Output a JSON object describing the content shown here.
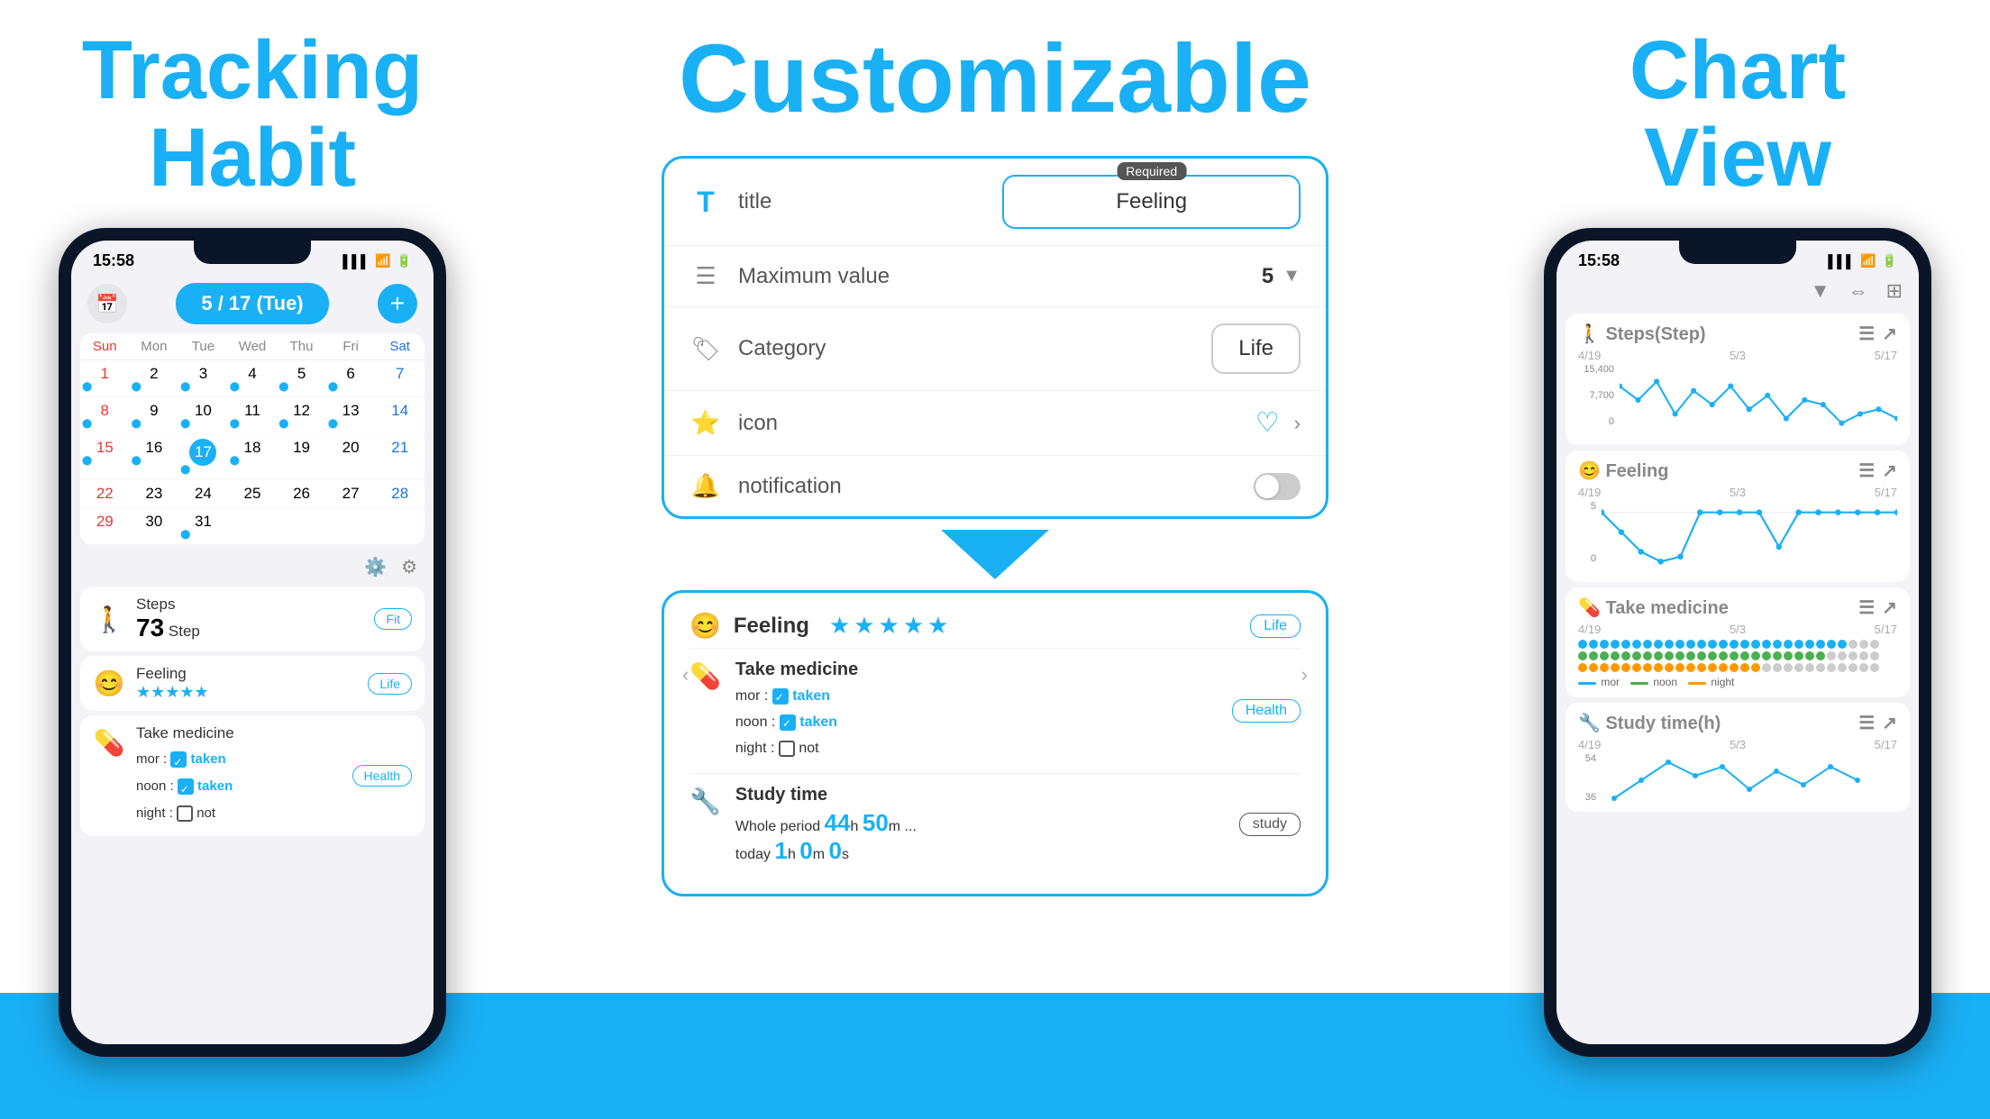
{
  "left": {
    "title_line1": "Tracking",
    "title_line2": "Habit",
    "phone": {
      "status_time": "15:58",
      "date_pill": "5 / 17 (Tue)",
      "add_btn": "+",
      "days": [
        "Sun",
        "Mon",
        "Tue",
        "Wed",
        "Thu",
        "Fri",
        "Sat"
      ],
      "weeks": [
        [
          "1",
          "2",
          "3",
          "4",
          "5",
          "6",
          "7"
        ],
        [
          "8",
          "9",
          "10",
          "11",
          "12",
          "13",
          "14"
        ],
        [
          "15",
          "16",
          "17",
          "18",
          "19",
          "20",
          "21"
        ],
        [
          "22",
          "23",
          "24",
          "25",
          "26",
          "27",
          "28"
        ],
        [
          "29",
          "30",
          "31",
          "",
          "",
          "",
          ""
        ]
      ],
      "habits": [
        {
          "icon": "🚶",
          "name": "Steps",
          "value": "73",
          "unit": "Step",
          "tag": "Fit",
          "stars": 0
        },
        {
          "icon": "😊",
          "name": "Feeling",
          "value": "",
          "unit": "",
          "tag": "Life",
          "stars": 5
        },
        {
          "icon": "💊",
          "name": "Take medicine",
          "tag": "Health",
          "lines": [
            "mor : taken",
            "noon : taken",
            "night : not"
          ]
        }
      ]
    }
  },
  "mid": {
    "title": "Customizable",
    "form": {
      "title_icon": "T",
      "title_label": "title",
      "required_badge": "Required",
      "title_value": "Feeling",
      "max_label": "Maximum value",
      "max_value": "5",
      "category_label": "Category",
      "category_value": "Life",
      "icon_label": "icon",
      "notification_label": "notification"
    },
    "preview": {
      "feeling_name": "Feeling",
      "feeling_stars": 5,
      "life_tag": "Life",
      "medicine_name": "Take medicine",
      "med_lines": [
        "mor : taken",
        "noon : taken",
        "night : not"
      ],
      "health_tag": "Health",
      "study_name": "Study time",
      "study_whole": "44",
      "study_whole_m": "50",
      "study_today_h": "1",
      "study_today_m": "0",
      "study_today_s": "0",
      "study_tag": "study"
    }
  },
  "right": {
    "title_line1": "Chart",
    "title_line2": "View",
    "phone": {
      "status_time": "15:58",
      "charts": [
        {
          "icon": "🚶",
          "name": "Steps(Step)",
          "dates": [
            "4/19",
            "5/3",
            "5/17"
          ],
          "y_labels": [
            "15,400",
            "7,700",
            "0"
          ]
        },
        {
          "icon": "😊",
          "name": "Feeling",
          "dates": [
            "4/19",
            "5/3",
            "5/17"
          ],
          "y_labels": [
            "5",
            "",
            "0"
          ]
        },
        {
          "icon": "💊",
          "name": "Take medicine",
          "dates": [
            "4/19",
            "5/3",
            "5/17"
          ],
          "legend": [
            "mor",
            "noon",
            "night"
          ]
        },
        {
          "icon": "🔧",
          "name": "Study time(h)",
          "dates": [
            "4/19",
            "5/3",
            "5/17"
          ],
          "y_labels": [
            "54",
            "36"
          ]
        }
      ]
    }
  }
}
